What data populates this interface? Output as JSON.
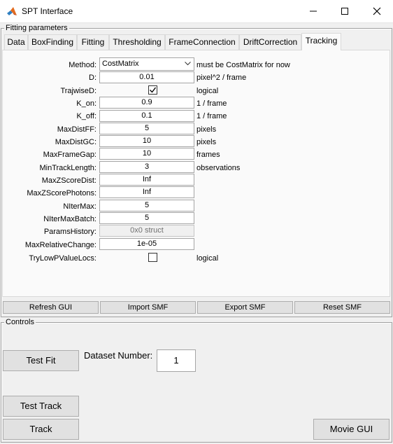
{
  "window": {
    "title": "SPT Interface"
  },
  "fitting_panel": {
    "title": "Fitting parameters",
    "tabs": [
      {
        "label": "Data"
      },
      {
        "label": "BoxFinding"
      },
      {
        "label": "Fitting"
      },
      {
        "label": "Thresholding"
      },
      {
        "label": "FrameConnection"
      },
      {
        "label": "DriftCorrection"
      },
      {
        "label": "Tracking"
      }
    ],
    "active_tab": "Tracking",
    "params": {
      "method": {
        "label": "Method:",
        "value": "CostMatrix",
        "note": "must be CostMatrix for now"
      },
      "d": {
        "label": "D:",
        "value": "0.01",
        "unit": "pixel^2 / frame"
      },
      "trajwised": {
        "label": "TrajwiseD:",
        "checked": true,
        "unit": "logical"
      },
      "k_on": {
        "label": "K_on:",
        "value": "0.9",
        "unit": "1 / frame"
      },
      "k_off": {
        "label": "K_off:",
        "value": "0.1",
        "unit": "1 / frame"
      },
      "maxdistff": {
        "label": "MaxDistFF:",
        "value": "5",
        "unit": "pixels"
      },
      "maxdistgc": {
        "label": "MaxDistGC:",
        "value": "10",
        "unit": "pixels"
      },
      "maxframegap": {
        "label": "MaxFrameGap:",
        "value": "10",
        "unit": "frames"
      },
      "mintracklength": {
        "label": "MinTrackLength:",
        "value": "3",
        "unit": "observations"
      },
      "maxzscoredist": {
        "label": "MaxZScoreDist:",
        "value": "Inf"
      },
      "maxzscorephotons": {
        "label": "MaxZScorePhotons:",
        "value": "Inf"
      },
      "nitermax": {
        "label": "NIterMax:",
        "value": "5"
      },
      "nitermaxbatch": {
        "label": "NIterMaxBatch:",
        "value": "5"
      },
      "paramshistory": {
        "label": "ParamsHistory:",
        "value": "0x0 struct"
      },
      "maxrelativechange": {
        "label": "MaxRelativeChange:",
        "value": "1e-05"
      },
      "trylowpvaluelocs": {
        "label": "TryLowPValueLocs:",
        "checked": false,
        "unit": "logical"
      }
    },
    "buttons": {
      "refresh": "Refresh GUI",
      "import": "Import SMF",
      "export": "Export SMF",
      "reset": "Reset SMF"
    }
  },
  "controls_panel": {
    "title": "Controls",
    "test_fit": "Test Fit",
    "dataset_label": "Dataset Number:",
    "dataset_value": "1",
    "test_track": "Test Track",
    "track": "Track",
    "movie_gui": "Movie GUI"
  }
}
